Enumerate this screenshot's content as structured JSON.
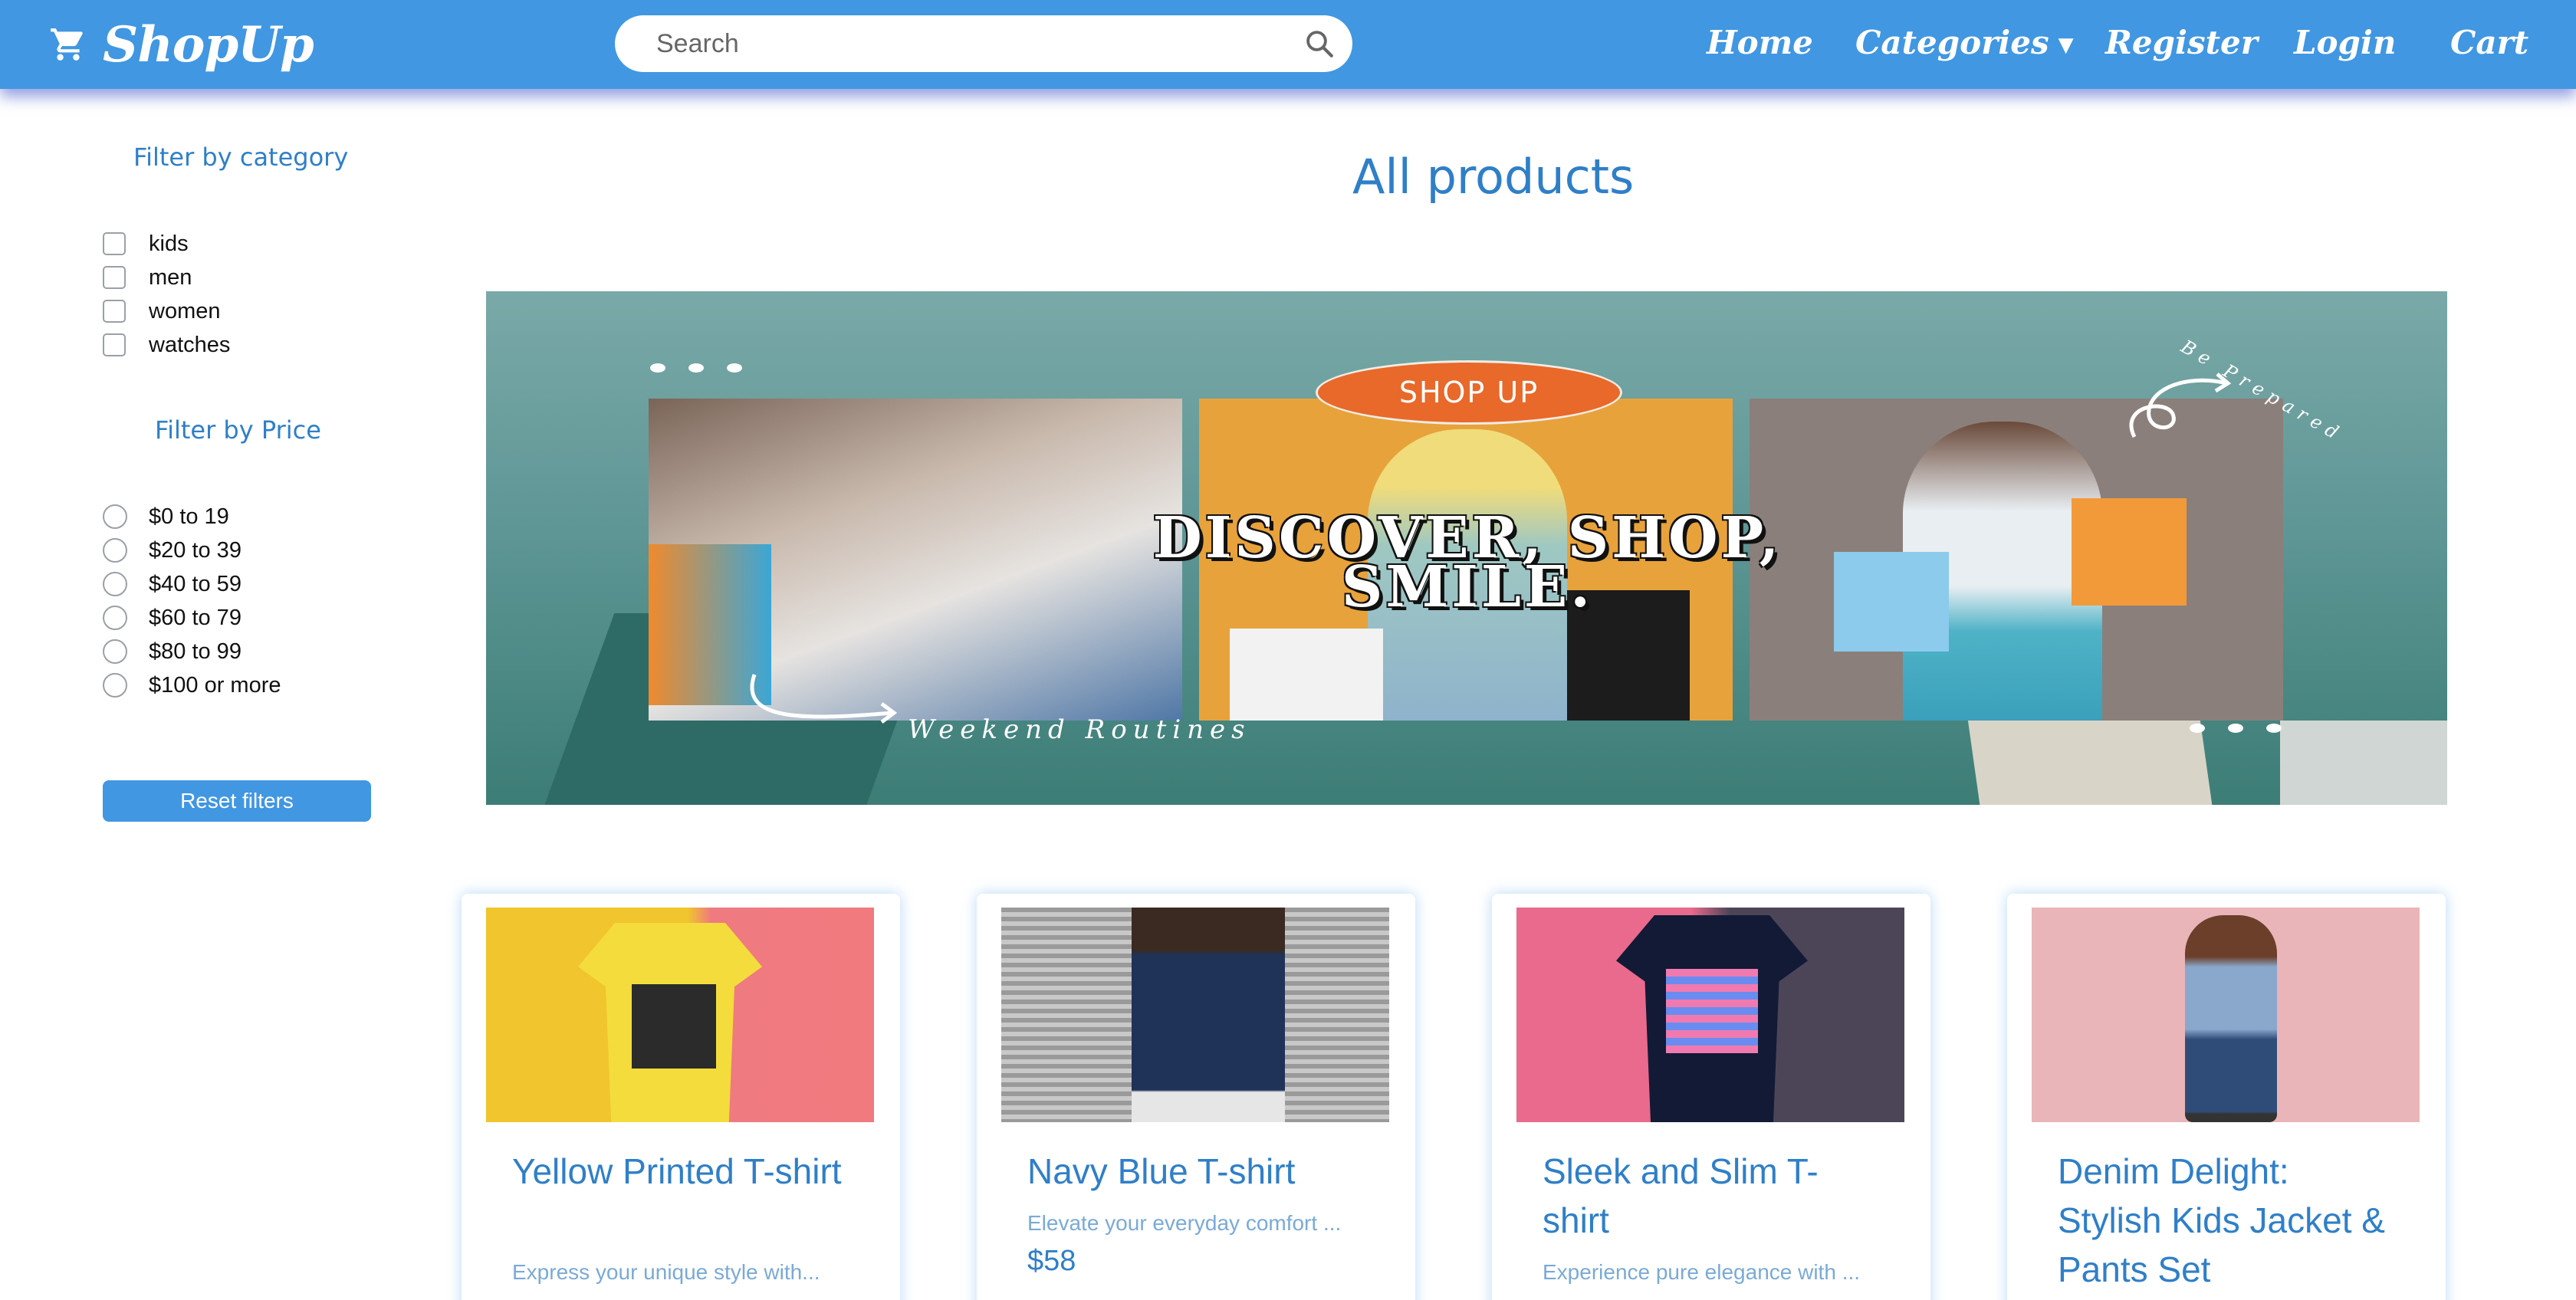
{
  "navbar": {
    "brand": "ShopUp",
    "search_placeholder": "Search",
    "links": {
      "home": "Home",
      "categories": "Categories",
      "register": "Register",
      "login": "Login",
      "cart": "Cart"
    }
  },
  "sidebar": {
    "category_title": "Filter by category",
    "categories": [
      "kids",
      "men",
      "women",
      "watches"
    ],
    "price_title": "Filter by Price",
    "prices": [
      "$0 to 19",
      "$20 to 39",
      "$40 to 59",
      "$60 to 79",
      "$80 to 99",
      "$100 or more"
    ],
    "reset_label": "Reset filters"
  },
  "main": {
    "title": "All products",
    "banner": {
      "badge": "SHOP UP",
      "headline_line1": "DISCOVER, SHOP,",
      "headline_line2": "SMILE.",
      "tagline": "Weekend Routines",
      "corner_text": "Be Prepared"
    },
    "products": [
      {
        "name": "Yellow Printed T-shirt",
        "description": "Express your unique style with...",
        "price": ""
      },
      {
        "name": "Navy Blue T-shirt",
        "description": "Elevate your everyday comfort ...",
        "price": "$58"
      },
      {
        "name": "Sleek and Slim T-shirt",
        "description": "Experience pure elegance with ...",
        "price": ""
      },
      {
        "name": "Denim Delight: Stylish Kids Jacket & Pants Set",
        "description": "",
        "price": ""
      }
    ]
  },
  "colors": {
    "primary": "#4197e1",
    "accent_text": "#2f7fc8",
    "muted_text": "#7aaad6",
    "badge": "#e8692a"
  }
}
